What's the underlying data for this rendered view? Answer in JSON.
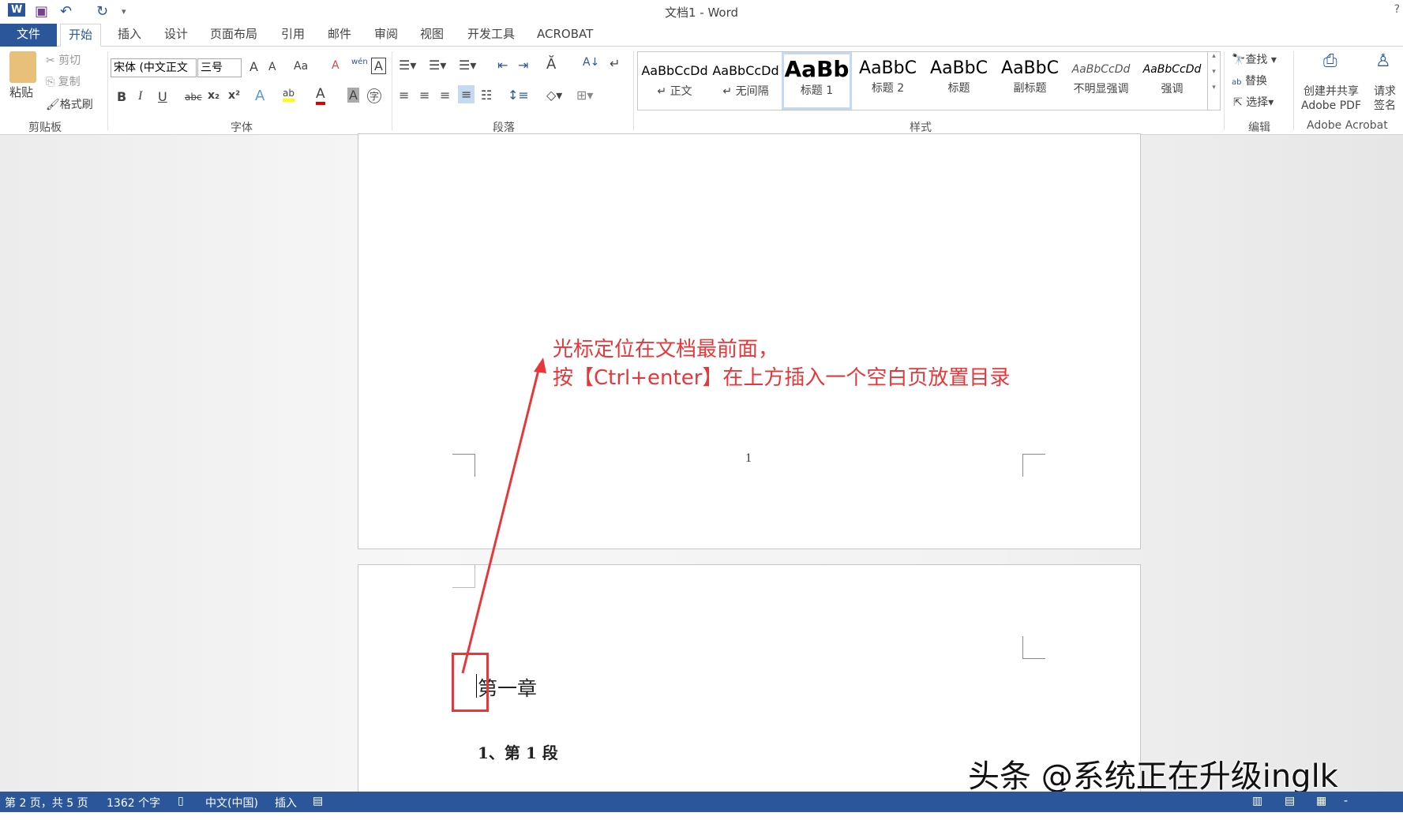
{
  "window": {
    "title": "文档1 - Word",
    "help": "?"
  },
  "quick_access": {
    "word_icon": "W",
    "save_icon": "save-icon",
    "undo_icon": "undo-icon",
    "redo_icon": "redo-icon",
    "customize": "▾"
  },
  "tabs": [
    "文件",
    "开始",
    "插入",
    "设计",
    "页面布局",
    "引用",
    "邮件",
    "审阅",
    "视图",
    "开发工具",
    "ACROBAT"
  ],
  "clipboard": {
    "paste": "粘贴",
    "cut": "剪切",
    "copy": "复制",
    "format_painter": "格式刷",
    "label": "剪贴板"
  },
  "font": {
    "name": "宋体 (中文正文",
    "size": "三号",
    "grow": "A",
    "shrink": "A",
    "case": "Aa",
    "clear": "A",
    "phonetic": "wén",
    "border": "A",
    "bold": "B",
    "italic": "I",
    "underline": "U",
    "strike": "abc",
    "sub": "x₂",
    "sup": "x²",
    "effects": "A",
    "highlight": "ab",
    "color": "A",
    "shade": "A",
    "enclose": "字",
    "label": "字体",
    "highlight_color": "#ffff00",
    "font_color": "#e00000"
  },
  "paragraph": {
    "label": "段落"
  },
  "styles": {
    "label": "样式",
    "items": [
      {
        "preview": "AaBbCcDd",
        "name": "↵ 正文"
      },
      {
        "preview": "AaBbCcDd",
        "name": "↵ 无间隔"
      },
      {
        "preview": "AaBb",
        "name": "标题 1"
      },
      {
        "preview": "AaBbC",
        "name": "标题 2"
      },
      {
        "preview": "AaBbC",
        "name": "标题"
      },
      {
        "preview": "AaBbC",
        "name": "副标题"
      },
      {
        "preview": "AaBbCcDd",
        "name": "不明显强调"
      },
      {
        "preview": "AaBbCcDd",
        "name": "强调"
      }
    ]
  },
  "editing": {
    "find": "查找",
    "replace": "替换",
    "select": "选择",
    "label": "编辑"
  },
  "acrobat": {
    "create_line1": "创建并共享",
    "create_line2": "Adobe PDF",
    "sign_line1": "请求",
    "sign_line2": "签名",
    "label": "Adobe Acrobat"
  },
  "document": {
    "page_number": "1",
    "heading": "第一章",
    "paragraph": "1、第 1 段"
  },
  "annotation": {
    "line1": "光标定位在文档最前面，",
    "line2": "按【Ctrl+enter】在上方插入一个空白页放置目录",
    "color": "#e8373a"
  },
  "watermark": "头条 @系统正在升级inglk",
  "status": {
    "page": "第 2 页，共 5 页",
    "words": "1362 个字",
    "language": "中文(中国)",
    "mode": "插入"
  },
  "colors": {
    "accent": "#2b579a"
  }
}
